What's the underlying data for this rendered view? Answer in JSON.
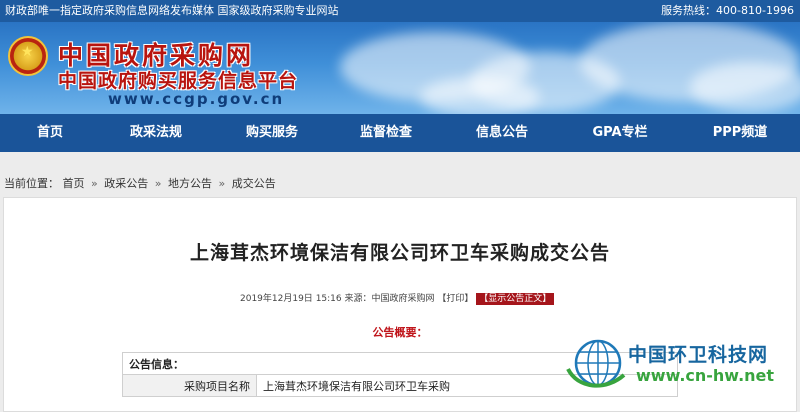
{
  "topbar": {
    "left_text": "财政部唯一指定政府采购信息网络发布媒体 国家级政府采购专业网站",
    "right_text": "服务热线：400-810-1996"
  },
  "banner": {
    "title_line1": "中国政府采购网",
    "title_line2": "中国政府购买服务信息平台",
    "url": "www.ccgp.gov.cn"
  },
  "nav": {
    "items": [
      "首页",
      "政采法规",
      "购买服务",
      "监督检查",
      "信息公告",
      "GPA专栏",
      "PPP频道"
    ]
  },
  "breadcrumb": {
    "prefix": "当前位置：",
    "items": [
      "首页",
      "政采公告",
      "地方公告",
      "成交公告"
    ],
    "separator": "»"
  },
  "article": {
    "title": "上海茸杰环境保洁有限公司环卫车采购成交公告",
    "date": "2019年12月19日",
    "time": "15:16",
    "source_label": "来源：",
    "source": "中国政府采购网",
    "print_label": "【打印】",
    "show_label": "【显示公告正文】",
    "section_heading": "公告概要："
  },
  "info_table": {
    "header": "公告信息：",
    "rows": [
      {
        "label": "采购项目名称",
        "value": "上海茸杰环境保洁有限公司环卫车采购"
      }
    ]
  },
  "watermark": {
    "name": "中国环卫科技网",
    "url": "www.cn-hw.net"
  },
  "colors": {
    "topbar": "#1e5ba0",
    "nav": "#1a5499",
    "brand_red": "#b8140f",
    "accent_red": "#a5151b",
    "watermark_blue": "#17669f",
    "watermark_green": "#38a43e"
  },
  "icons": {
    "emblem": "national-emblem-icon",
    "watermark_logo": "globe-icon"
  }
}
